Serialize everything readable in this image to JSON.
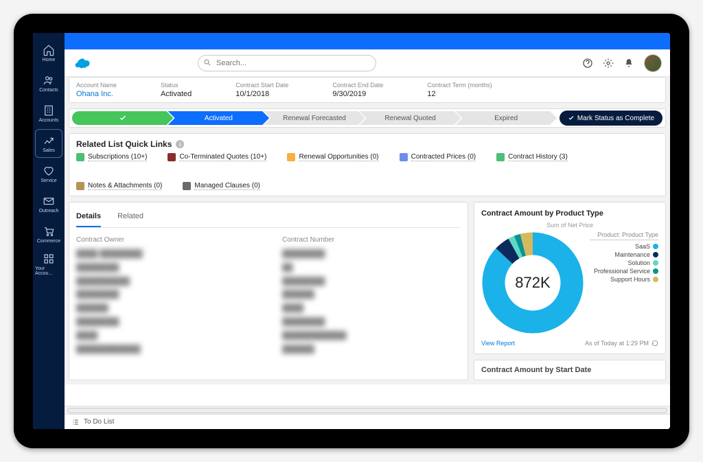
{
  "nav": {
    "items": [
      {
        "label": "Home"
      },
      {
        "label": "Contacts"
      },
      {
        "label": "Accounts"
      },
      {
        "label": "Sales"
      },
      {
        "label": "Service"
      },
      {
        "label": "Outreach"
      },
      {
        "label": "Commerce"
      },
      {
        "label": "Your Accou..."
      }
    ]
  },
  "search": {
    "placeholder": "Search..."
  },
  "summary": {
    "account_label": "Account Name",
    "account_value": "Ohana Inc.",
    "status_label": "Status",
    "status_value": "Activated",
    "start_label": "Contract Start Date",
    "start_value": "10/1/2018",
    "end_label": "Contract End Date",
    "end_value": "9/30/2019",
    "term_label": "Contract Term (months)",
    "term_value": "12"
  },
  "path": {
    "stages": [
      "Activated",
      "Renewal Forecasted",
      "Renewal Quoted",
      "Expired"
    ],
    "complete_label": "Mark Status as Complete"
  },
  "quicklinks": {
    "title": "Related List Quick Links",
    "items": [
      {
        "label": "Subscriptions (10+)",
        "color": "#4bc076"
      },
      {
        "label": "Co-Terminated Quotes (10+)",
        "color": "#8b2d2d"
      },
      {
        "label": "Renewal Opportunities (0)",
        "color": "#f5b041"
      },
      {
        "label": "Contracted Prices (0)",
        "color": "#6f8de8"
      },
      {
        "label": "Contract History (3)",
        "color": "#4bc076"
      },
      {
        "label": "Notes & Attachments (0)",
        "color": "#b89256"
      },
      {
        "label": "Managed Clauses (0)",
        "color": "#6b6b6b"
      }
    ]
  },
  "details": {
    "tabs": [
      "Details",
      "Related"
    ],
    "owner_label": "Contract Owner",
    "number_label": "Contract Number"
  },
  "donut_card": {
    "title": "Contract Amount by Product Type",
    "subtitle": "Sum of Net Price",
    "center": "872K",
    "legend_title": "Product: Product Type",
    "legend": [
      {
        "label": "SaaS",
        "color": "#1ab2e8"
      },
      {
        "label": "Maintenance",
        "color": "#0a2b5c"
      },
      {
        "label": "Solution",
        "color": "#5dd9c1"
      },
      {
        "label": "Professional Service",
        "color": "#0a9396"
      },
      {
        "label": "Support Hours",
        "color": "#d4b95e"
      }
    ],
    "view_report": "View Report",
    "asof": "As of Today at 1:29 PM"
  },
  "second_chart_title": "Contract Amount by Start Date",
  "todo_label": "To Do List",
  "chart_data": {
    "type": "pie",
    "title": "Contract Amount by Product Type",
    "subtitle": "Sum of Net Price",
    "total_label": "872K",
    "series": [
      {
        "name": "SaaS",
        "value": 87,
        "color": "#1ab2e8"
      },
      {
        "name": "Maintenance",
        "value": 5,
        "color": "#0a2b5c"
      },
      {
        "name": "Solution",
        "value": 2,
        "color": "#5dd9c1"
      },
      {
        "name": "Professional Service",
        "value": 2,
        "color": "#0a9396"
      },
      {
        "name": "Support Hours",
        "value": 4,
        "color": "#d4b95e"
      }
    ]
  }
}
